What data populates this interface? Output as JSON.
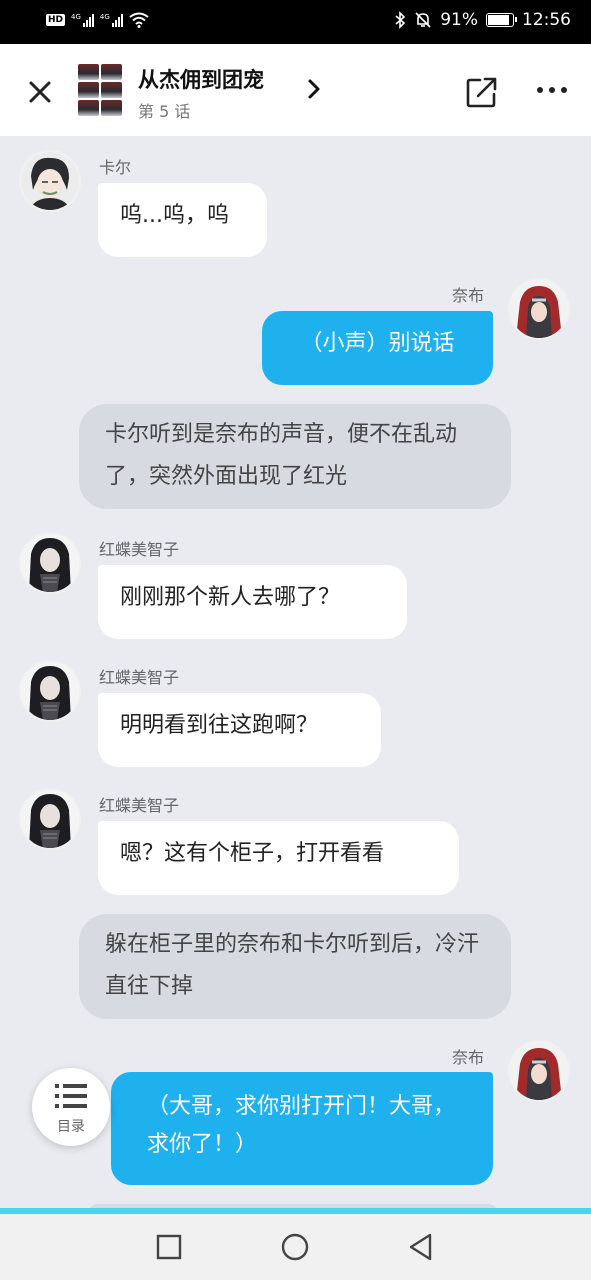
{
  "status_bar": {
    "hd": "HD",
    "net1": "4G",
    "net2": "4G",
    "battery": "91%",
    "battery_level": 0.91,
    "time": "12:56"
  },
  "header": {
    "title": "从杰佣到团宠",
    "episode": "第 5 话"
  },
  "messages": [
    {
      "kind": "left",
      "name": "卡尔",
      "text": "呜...呜，呜",
      "avatar": "karl-avatar"
    },
    {
      "kind": "right",
      "name": "奈布",
      "text": "（小声）别说话",
      "avatar": "naib-avatar"
    },
    {
      "kind": "narration",
      "text": "卡尔听到是奈布的声音，便不在乱动了，突然外面出现了红光"
    },
    {
      "kind": "left",
      "name": "红蝶美智子",
      "text": "刚刚那个新人去哪了？",
      "avatar": "michiko-avatar"
    },
    {
      "kind": "left",
      "name": "红蝶美智子",
      "text": "明明看到往这跑啊？",
      "avatar": "michiko-avatar"
    },
    {
      "kind": "left",
      "name": "红蝶美智子",
      "text": "嗯？这有个柜子，打开看看",
      "avatar": "michiko-avatar"
    },
    {
      "kind": "narration",
      "text": "躲在柜子里的奈布和卡尔听到后，冷汗直往下掉"
    },
    {
      "kind": "right",
      "name": "奈布",
      "text": "（大哥，求你别打开门！大哥，求你了！）",
      "avatar": "naib-avatar"
    }
  ],
  "toc": {
    "label": "目录",
    "icon": "list-icon"
  },
  "colors": {
    "accent": "#1fb0ee",
    "bottom_line": "#4ad6e8"
  }
}
